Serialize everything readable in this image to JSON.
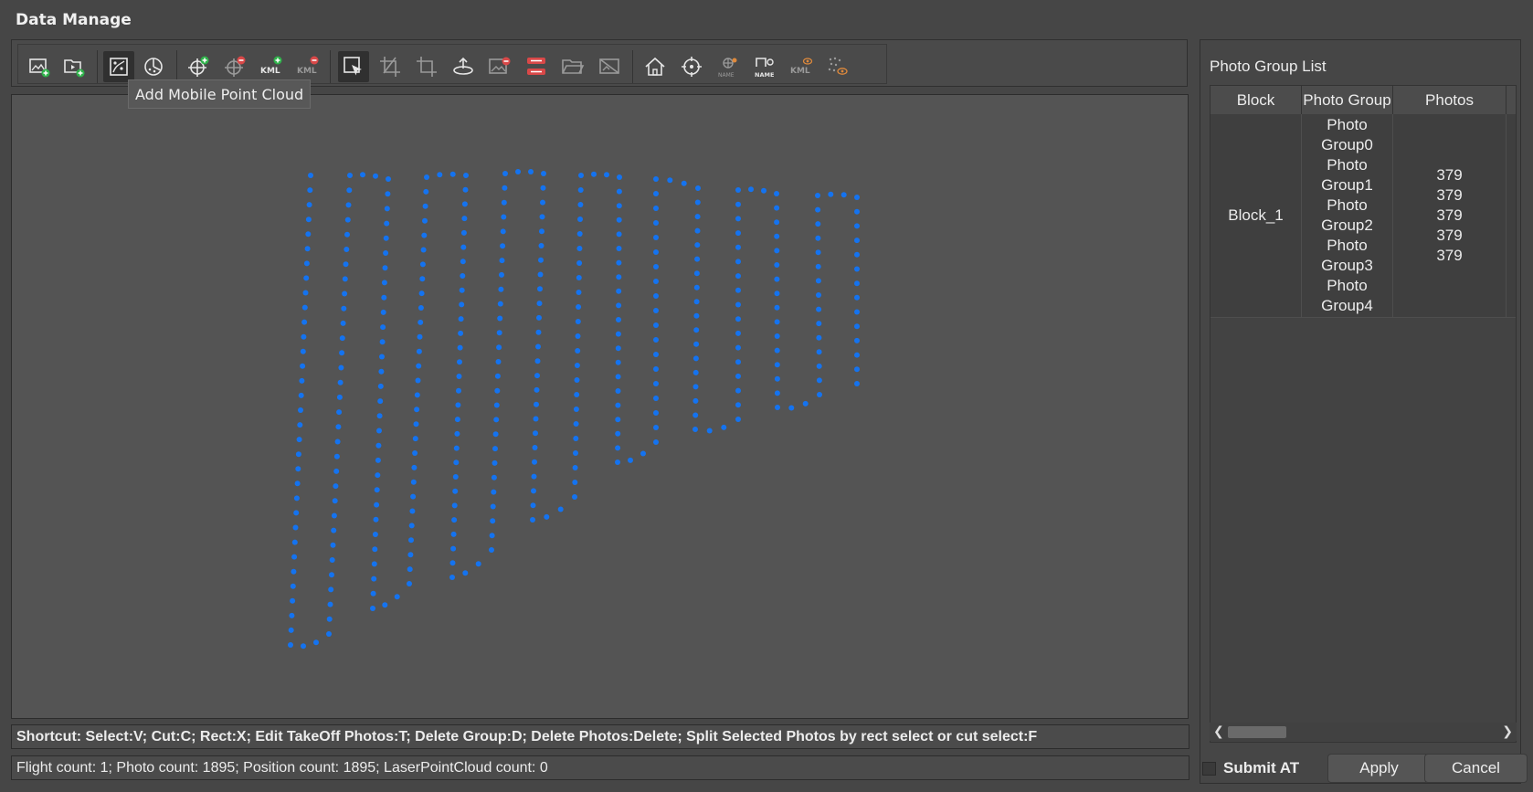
{
  "window": {
    "title": "Data Manage"
  },
  "toolbar": {
    "buttons": [
      {
        "name": "add-photos-button",
        "icon": "image-add-icon"
      },
      {
        "name": "add-video-button",
        "icon": "video-add-icon"
      },
      {
        "name": "add-mobile-point-cloud-button",
        "icon": "mobile-point-cloud-icon",
        "active": true
      },
      {
        "name": "add-point-cloud-button",
        "icon": "point-cloud-icon"
      },
      {
        "name": "add-control-point-button",
        "icon": "crosshair-add-icon"
      },
      {
        "name": "remove-control-point-button",
        "icon": "crosshair-remove-icon"
      },
      {
        "name": "import-kml-button",
        "icon": "kml-add-icon"
      },
      {
        "name": "remove-kml-button",
        "icon": "kml-remove-icon"
      },
      {
        "name": "select-tool-button",
        "icon": "select-cursor-icon",
        "active": true
      },
      {
        "name": "cut-tool-button",
        "icon": "cut-icon"
      },
      {
        "name": "crop-tool-button",
        "icon": "crop-icon"
      },
      {
        "name": "edit-takeoff-button",
        "icon": "takeoff-icon"
      },
      {
        "name": "delete-photos-button",
        "icon": "image-remove-icon"
      },
      {
        "name": "delete-group-button",
        "icon": "group-remove-icon"
      },
      {
        "name": "open-folder-button",
        "icon": "folder-open-icon"
      },
      {
        "name": "hide-images-button",
        "icon": "image-hide-icon"
      },
      {
        "name": "home-view-button",
        "icon": "home-icon"
      },
      {
        "name": "locate-button",
        "icon": "target-icon"
      },
      {
        "name": "show-names-button",
        "icon": "name-eye-icon"
      },
      {
        "name": "edit-names-button",
        "icon": "name-edit-icon"
      },
      {
        "name": "show-kml-button",
        "icon": "kml-eye-icon"
      },
      {
        "name": "show-points-button",
        "icon": "points-eye-icon"
      }
    ],
    "labels": {
      "kml": "KML",
      "name": "NAME"
    }
  },
  "tooltip": {
    "text": "Add Mobile Point Cloud"
  },
  "shortcut_bar": {
    "text": "Shortcut: Select:V; Cut:C; Rect:X; Edit TakeOff Photos:T; Delete Group:D; Delete Photos:Delete; Split Selected Photos by rect select or cut select:F"
  },
  "stats_bar": {
    "text": "Flight count: 1; Photo count: 1895; Position count: 1895; LaserPointCloud count: 0"
  },
  "photo_group_panel": {
    "title": "Photo Group List",
    "columns": [
      "Block",
      "Photo Group",
      "Photos"
    ],
    "rows": [
      {
        "block": "Block_1",
        "groups": [
          "Photo Group0",
          "Photo Group1",
          "Photo Group2",
          "Photo Group3",
          "Photo Group4"
        ],
        "photos": [
          "379",
          "379",
          "379",
          "379",
          "379"
        ]
      }
    ]
  },
  "footer": {
    "submit_at_label": "Submit AT",
    "submit_at_checked": false,
    "apply_label": "Apply",
    "cancel_label": "Cancel"
  },
  "flight_path": {
    "point_color": "#1473f0",
    "description_free": true
  },
  "colors": {
    "background": "#464646",
    "view_background": "#545454",
    "accent": "#1473f0"
  }
}
